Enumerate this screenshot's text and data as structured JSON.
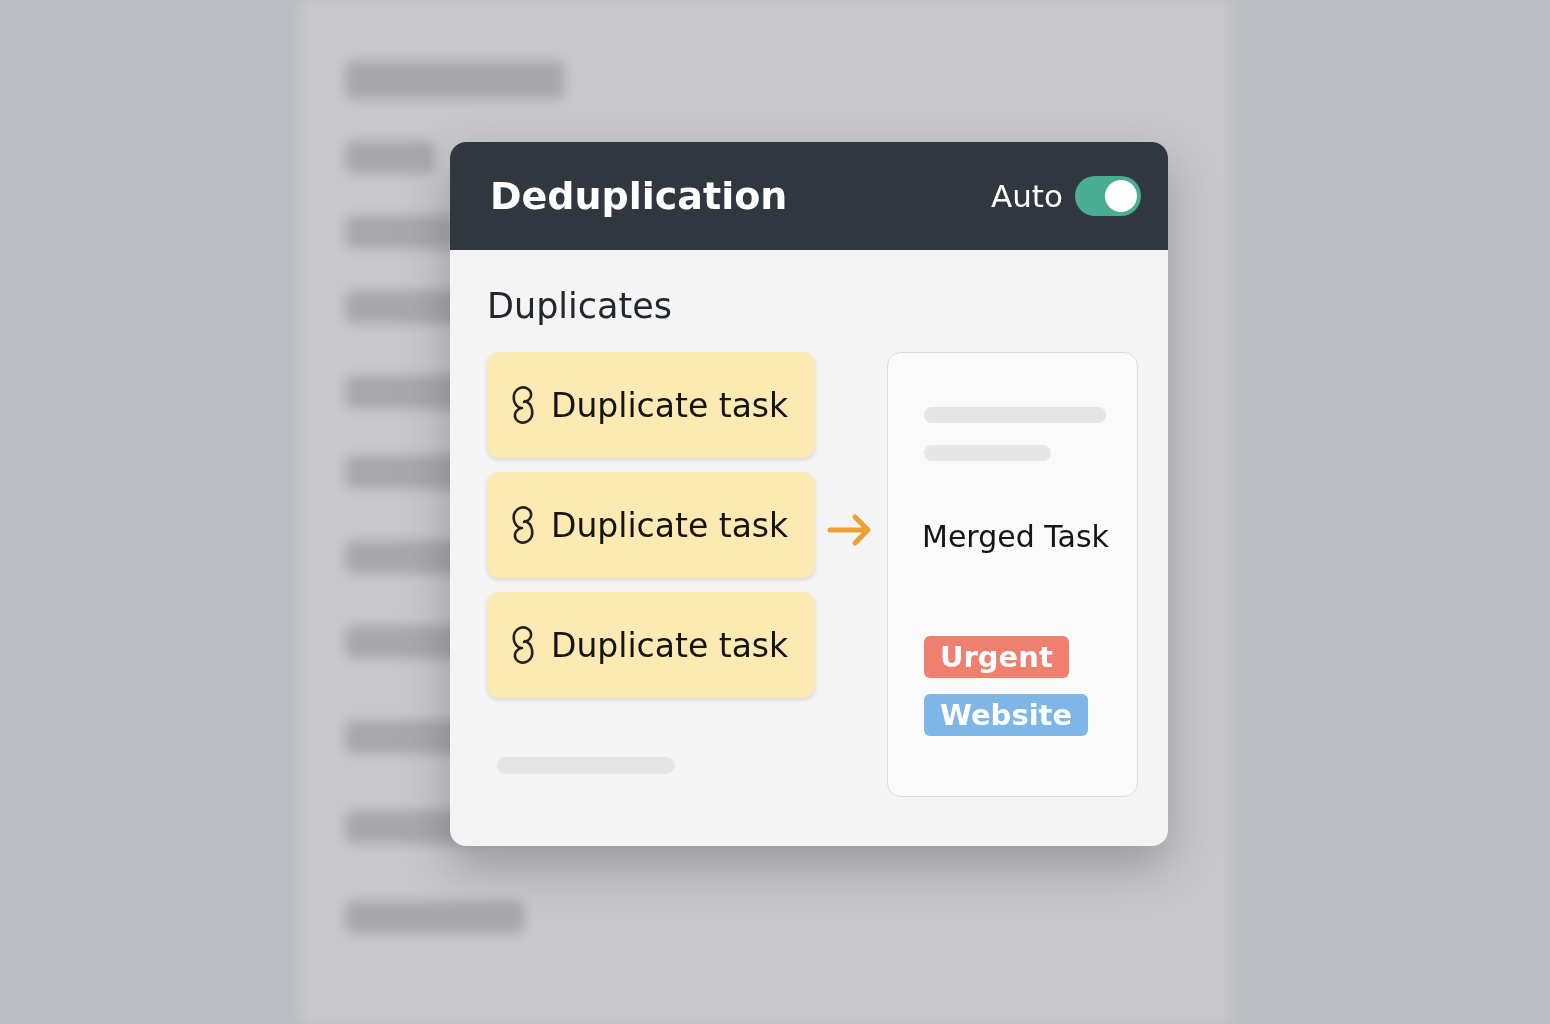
{
  "dialog": {
    "title": "Deduplication",
    "auto_label": "Auto",
    "auto_on": true
  },
  "section_title": "Duplicates",
  "duplicates": [
    {
      "label": "Duplicate task"
    },
    {
      "label": "Duplicate task"
    },
    {
      "label": "Duplicate task"
    }
  ],
  "merged": {
    "title": "Merged Task",
    "tags": [
      {
        "label": "Urgent",
        "color": "#ef7f6f"
      },
      {
        "label": "Website",
        "color": "#7fb6e8"
      }
    ]
  }
}
